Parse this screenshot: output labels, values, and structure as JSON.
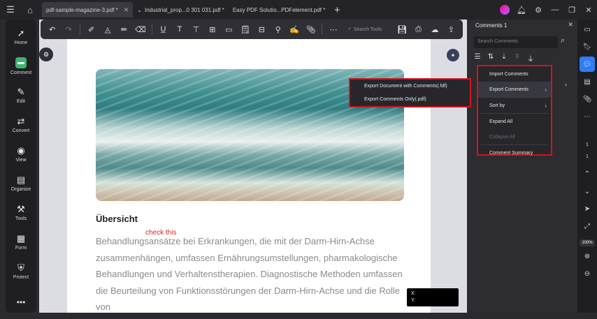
{
  "titlebar": {
    "tabs": [
      {
        "label": "pdf-sample-magazine-3.pdf *",
        "active": true
      },
      {
        "label": "Industrial_prop...0 301 031.pdf *",
        "active": false
      },
      {
        "label": "Easy PDF Solutio...PDFelement.pdf *",
        "active": false
      }
    ]
  },
  "leftnav": [
    {
      "label": "Home",
      "icon": "rocket-icon",
      "glyph": "🚀"
    },
    {
      "label": "Comment",
      "icon": "comment-icon",
      "glyph": "▬",
      "active": true
    },
    {
      "label": "Edit",
      "icon": "edit-icon",
      "glyph": "✎"
    },
    {
      "label": "Convert",
      "icon": "convert-icon",
      "glyph": "⇄"
    },
    {
      "label": "View",
      "icon": "eye-icon",
      "glyph": "◉"
    },
    {
      "label": "Organize",
      "icon": "organize-icon",
      "glyph": "▤"
    },
    {
      "label": "Tools",
      "icon": "tools-icon",
      "glyph": "⚒"
    },
    {
      "label": "Form",
      "icon": "form-icon",
      "glyph": "▦"
    },
    {
      "label": "Protect",
      "icon": "shield-icon",
      "glyph": "⛨"
    }
  ],
  "toolbar": {
    "search_placeholder": "Search Tools"
  },
  "document": {
    "heading": "Übersicht",
    "annotation": "check this",
    "paragraph": "Behandlungsansätze bei Erkrankungen, die mit der Darm-Hirn-Achse zusammenhängen, umfassen Ernährungsumstellungen, pharmakologische Behandlungen und Verhaltenstherapien. Diagnostische Methoden umfassen die Beurteilung von Funktionsstörungen der Darm-Hirn-Achse und die Rolle von",
    "coord_x": "X:",
    "coord_y": "Y:"
  },
  "comments_panel": {
    "title": "Comments 1",
    "search_placeholder": "Search Comments"
  },
  "menu": {
    "items": [
      {
        "label": "Import Comments"
      },
      {
        "label": "Export Comments",
        "submenu": true
      },
      {
        "label": "Sort by",
        "submenu": true
      },
      {
        "label": "Expand All"
      },
      {
        "label": "Collapse All",
        "disabled": true
      },
      {
        "label": "Comment Summary"
      }
    ]
  },
  "submenu": {
    "items": [
      {
        "label": "Export Document with Comments(.fdf)"
      },
      {
        "label": "Export Comments Only(.pdf)"
      }
    ]
  },
  "rail": {
    "page_number": "1",
    "page_total": "1",
    "zoom": "100%"
  },
  "colors": {
    "highlight_border": "#d4141a",
    "accent_blue": "#2f7cf6",
    "comment_green": "#3bb56b"
  }
}
